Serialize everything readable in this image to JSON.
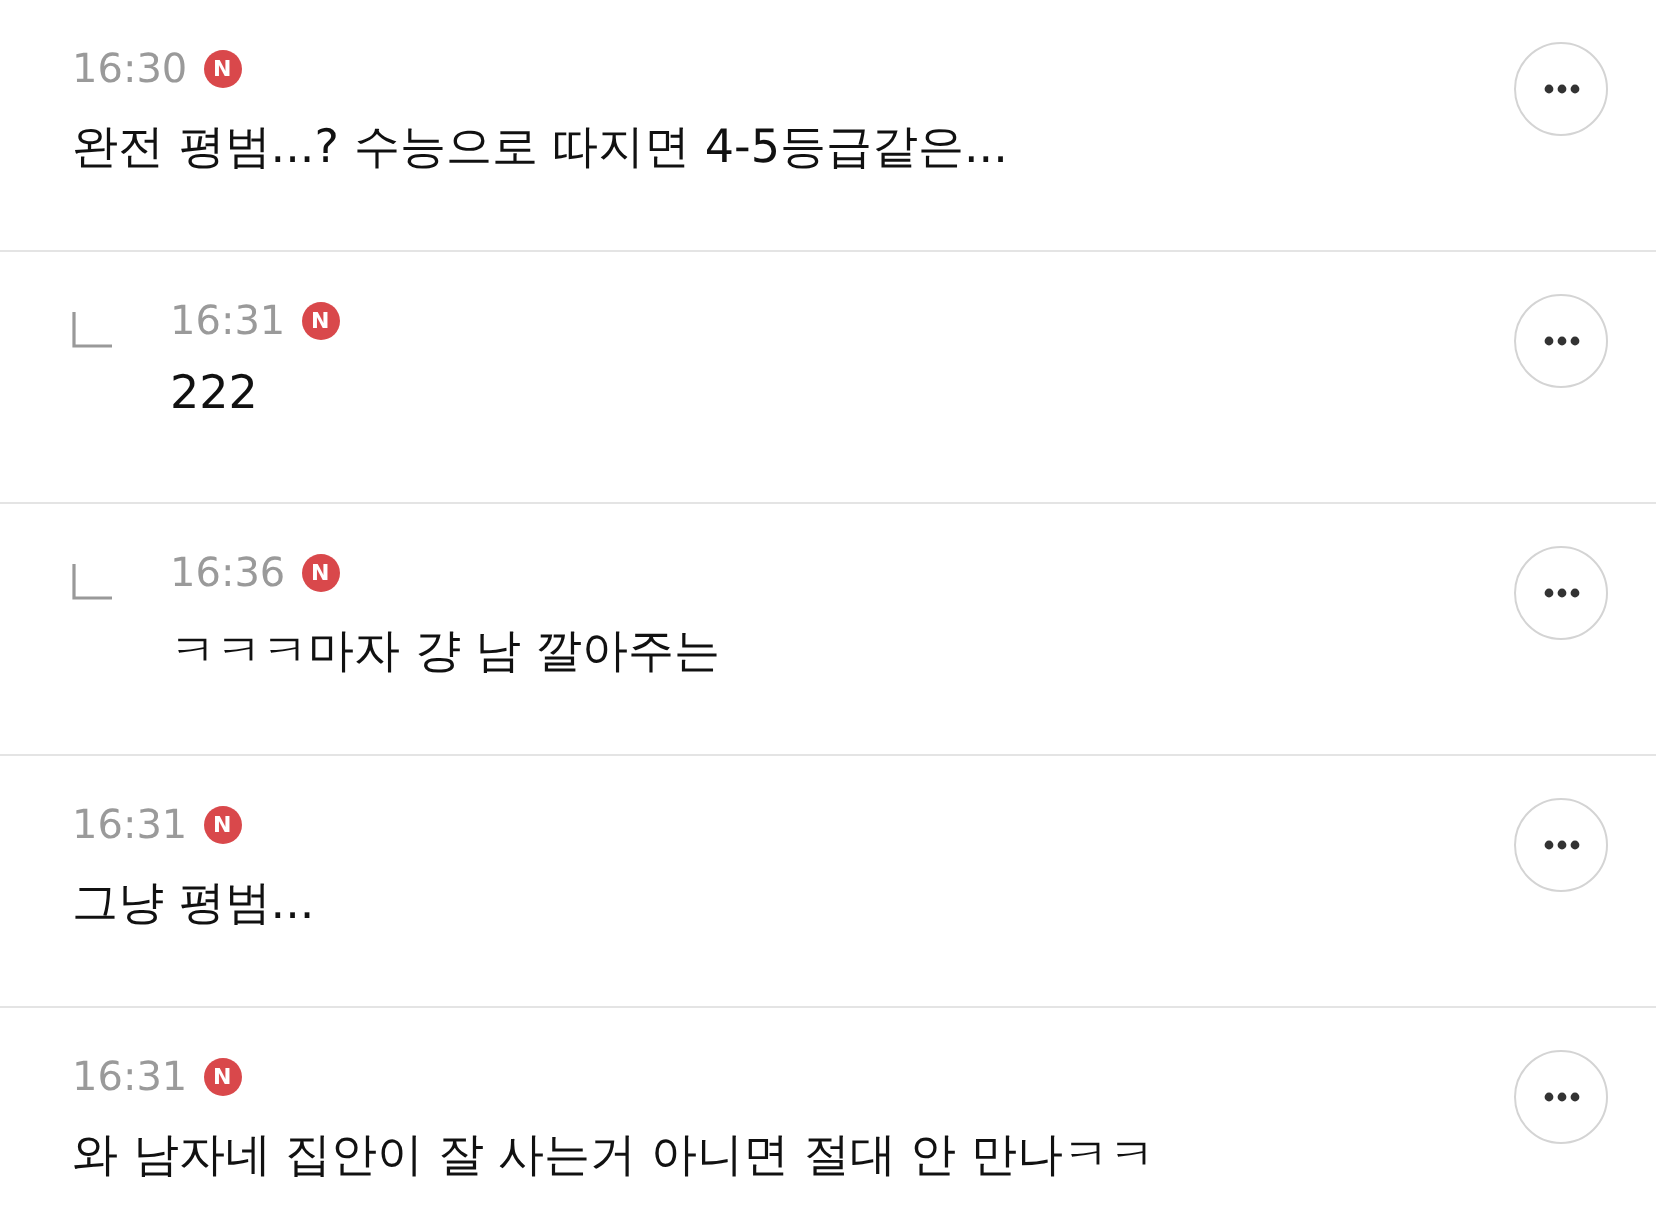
{
  "comments": [
    {
      "kind": "comment",
      "time": "16:30",
      "badge": "N",
      "text": "완전 평범...? 수능으로 따지면 4-5등급같은..."
    },
    {
      "kind": "reply",
      "time": "16:31",
      "badge": "N",
      "text": "222"
    },
    {
      "kind": "reply",
      "time": "16:36",
      "badge": "N",
      "text": "ㅋㅋㅋ마자 걍 남 깔아주는"
    },
    {
      "kind": "comment",
      "time": "16:31",
      "badge": "N",
      "text": "그냥 평범..."
    },
    {
      "kind": "comment",
      "time": "16:31",
      "badge": "N",
      "text": "와 남자네 집안이 잘 사는거 아니면 절대 안 만나ㅋㅋ"
    }
  ]
}
